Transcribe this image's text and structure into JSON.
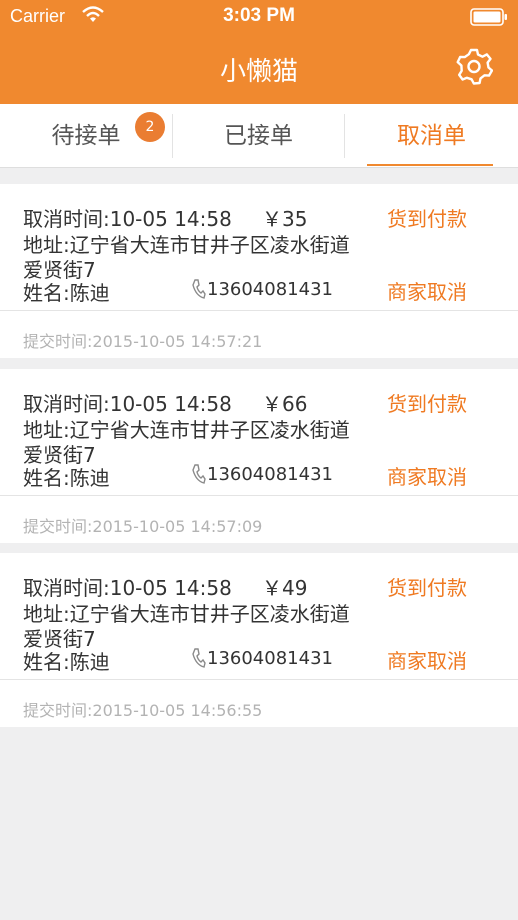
{
  "statusbar": {
    "carrier": "Carrier",
    "time": "3:03 PM"
  },
  "app_title": "小懒猫",
  "tabs": [
    {
      "label": "待接单",
      "badge": "2"
    },
    {
      "label": "已接单"
    },
    {
      "label": "取消单"
    }
  ],
  "orders": [
    {
      "cancel_time": "取消时间:10-05 14:58",
      "price": "￥35",
      "payment": "货到付款",
      "address_line1": "地址:辽宁省大连市甘井子区凌水街道",
      "address_line2": "爱贤街7",
      "name": "姓名:陈迪",
      "phone": "13604081431",
      "cancel_by": "商家取消",
      "submit_time": "提交时间:2015-10-05 14:57:21"
    },
    {
      "cancel_time": "取消时间:10-05 14:58",
      "price": "￥66",
      "payment": "货到付款",
      "address_line1": "地址:辽宁省大连市甘井子区凌水街道",
      "address_line2": "爱贤街7",
      "name": "姓名:陈迪",
      "phone": "13604081431",
      "cancel_by": "商家取消",
      "submit_time": "提交时间:2015-10-05 14:57:09"
    },
    {
      "cancel_time": "取消时间:10-05 14:58",
      "price": "￥49",
      "payment": "货到付款",
      "address_line1": "地址:辽宁省大连市甘井子区凌水街道",
      "address_line2": "爱贤街7",
      "name": "姓名:陈迪",
      "phone": "13604081431",
      "cancel_by": "商家取消",
      "submit_time": "提交时间:2015-10-05 14:56:55"
    }
  ],
  "colors": {
    "accent": "#f0892f",
    "action_text": "#ef7a22"
  },
  "icons": [
    "wifi-icon",
    "battery-icon",
    "gear-icon",
    "phone-icon"
  ]
}
